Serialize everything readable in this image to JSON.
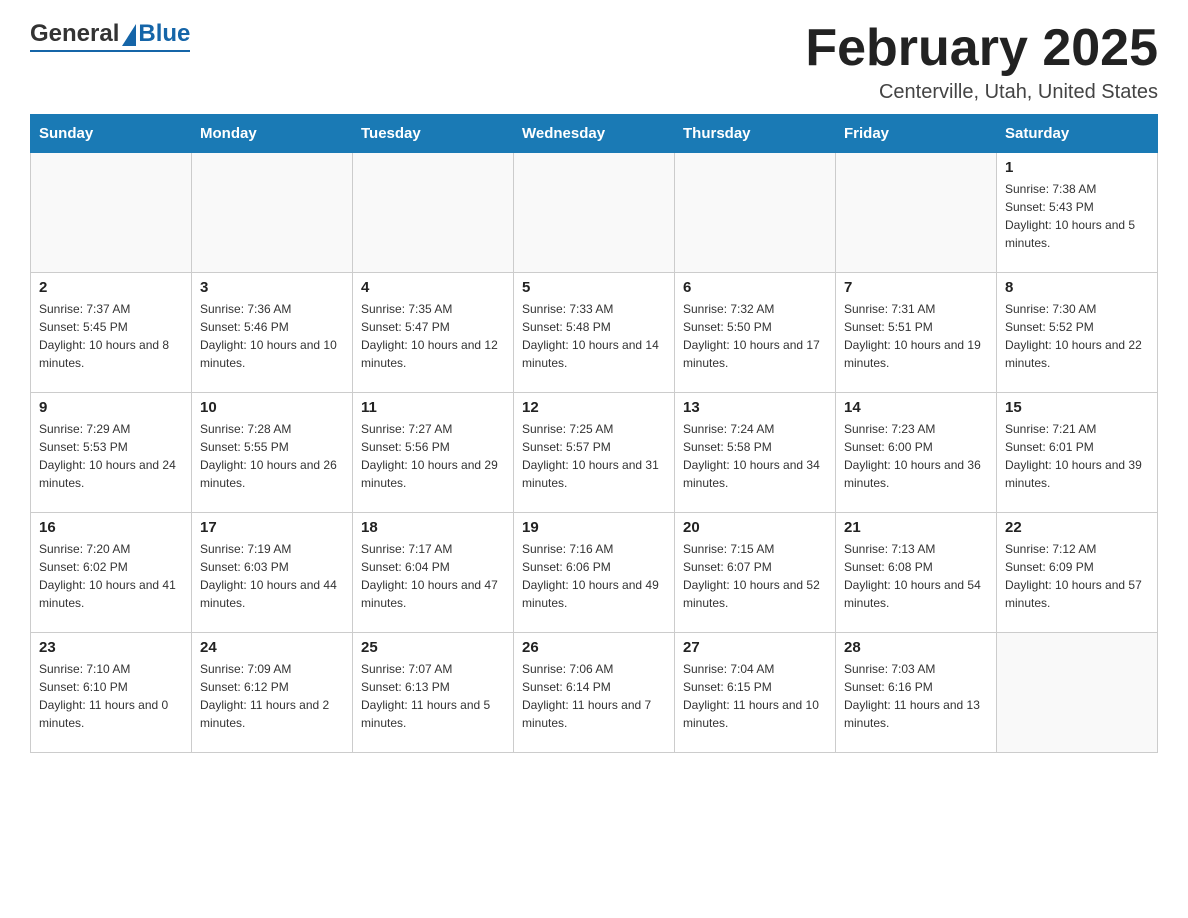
{
  "header": {
    "logo_general": "General",
    "logo_blue": "Blue",
    "month_title": "February 2025",
    "location": "Centerville, Utah, United States"
  },
  "weekdays": [
    "Sunday",
    "Monday",
    "Tuesday",
    "Wednesday",
    "Thursday",
    "Friday",
    "Saturday"
  ],
  "weeks": [
    [
      {
        "day": "",
        "sunrise": "",
        "sunset": "",
        "daylight": ""
      },
      {
        "day": "",
        "sunrise": "",
        "sunset": "",
        "daylight": ""
      },
      {
        "day": "",
        "sunrise": "",
        "sunset": "",
        "daylight": ""
      },
      {
        "day": "",
        "sunrise": "",
        "sunset": "",
        "daylight": ""
      },
      {
        "day": "",
        "sunrise": "",
        "sunset": "",
        "daylight": ""
      },
      {
        "day": "",
        "sunrise": "",
        "sunset": "",
        "daylight": ""
      },
      {
        "day": "1",
        "sunrise": "Sunrise: 7:38 AM",
        "sunset": "Sunset: 5:43 PM",
        "daylight": "Daylight: 10 hours and 5 minutes."
      }
    ],
    [
      {
        "day": "2",
        "sunrise": "Sunrise: 7:37 AM",
        "sunset": "Sunset: 5:45 PM",
        "daylight": "Daylight: 10 hours and 8 minutes."
      },
      {
        "day": "3",
        "sunrise": "Sunrise: 7:36 AM",
        "sunset": "Sunset: 5:46 PM",
        "daylight": "Daylight: 10 hours and 10 minutes."
      },
      {
        "day": "4",
        "sunrise": "Sunrise: 7:35 AM",
        "sunset": "Sunset: 5:47 PM",
        "daylight": "Daylight: 10 hours and 12 minutes."
      },
      {
        "day": "5",
        "sunrise": "Sunrise: 7:33 AM",
        "sunset": "Sunset: 5:48 PM",
        "daylight": "Daylight: 10 hours and 14 minutes."
      },
      {
        "day": "6",
        "sunrise": "Sunrise: 7:32 AM",
        "sunset": "Sunset: 5:50 PM",
        "daylight": "Daylight: 10 hours and 17 minutes."
      },
      {
        "day": "7",
        "sunrise": "Sunrise: 7:31 AM",
        "sunset": "Sunset: 5:51 PM",
        "daylight": "Daylight: 10 hours and 19 minutes."
      },
      {
        "day": "8",
        "sunrise": "Sunrise: 7:30 AM",
        "sunset": "Sunset: 5:52 PM",
        "daylight": "Daylight: 10 hours and 22 minutes."
      }
    ],
    [
      {
        "day": "9",
        "sunrise": "Sunrise: 7:29 AM",
        "sunset": "Sunset: 5:53 PM",
        "daylight": "Daylight: 10 hours and 24 minutes."
      },
      {
        "day": "10",
        "sunrise": "Sunrise: 7:28 AM",
        "sunset": "Sunset: 5:55 PM",
        "daylight": "Daylight: 10 hours and 26 minutes."
      },
      {
        "day": "11",
        "sunrise": "Sunrise: 7:27 AM",
        "sunset": "Sunset: 5:56 PM",
        "daylight": "Daylight: 10 hours and 29 minutes."
      },
      {
        "day": "12",
        "sunrise": "Sunrise: 7:25 AM",
        "sunset": "Sunset: 5:57 PM",
        "daylight": "Daylight: 10 hours and 31 minutes."
      },
      {
        "day": "13",
        "sunrise": "Sunrise: 7:24 AM",
        "sunset": "Sunset: 5:58 PM",
        "daylight": "Daylight: 10 hours and 34 minutes."
      },
      {
        "day": "14",
        "sunrise": "Sunrise: 7:23 AM",
        "sunset": "Sunset: 6:00 PM",
        "daylight": "Daylight: 10 hours and 36 minutes."
      },
      {
        "day": "15",
        "sunrise": "Sunrise: 7:21 AM",
        "sunset": "Sunset: 6:01 PM",
        "daylight": "Daylight: 10 hours and 39 minutes."
      }
    ],
    [
      {
        "day": "16",
        "sunrise": "Sunrise: 7:20 AM",
        "sunset": "Sunset: 6:02 PM",
        "daylight": "Daylight: 10 hours and 41 minutes."
      },
      {
        "day": "17",
        "sunrise": "Sunrise: 7:19 AM",
        "sunset": "Sunset: 6:03 PM",
        "daylight": "Daylight: 10 hours and 44 minutes."
      },
      {
        "day": "18",
        "sunrise": "Sunrise: 7:17 AM",
        "sunset": "Sunset: 6:04 PM",
        "daylight": "Daylight: 10 hours and 47 minutes."
      },
      {
        "day": "19",
        "sunrise": "Sunrise: 7:16 AM",
        "sunset": "Sunset: 6:06 PM",
        "daylight": "Daylight: 10 hours and 49 minutes."
      },
      {
        "day": "20",
        "sunrise": "Sunrise: 7:15 AM",
        "sunset": "Sunset: 6:07 PM",
        "daylight": "Daylight: 10 hours and 52 minutes."
      },
      {
        "day": "21",
        "sunrise": "Sunrise: 7:13 AM",
        "sunset": "Sunset: 6:08 PM",
        "daylight": "Daylight: 10 hours and 54 minutes."
      },
      {
        "day": "22",
        "sunrise": "Sunrise: 7:12 AM",
        "sunset": "Sunset: 6:09 PM",
        "daylight": "Daylight: 10 hours and 57 minutes."
      }
    ],
    [
      {
        "day": "23",
        "sunrise": "Sunrise: 7:10 AM",
        "sunset": "Sunset: 6:10 PM",
        "daylight": "Daylight: 11 hours and 0 minutes."
      },
      {
        "day": "24",
        "sunrise": "Sunrise: 7:09 AM",
        "sunset": "Sunset: 6:12 PM",
        "daylight": "Daylight: 11 hours and 2 minutes."
      },
      {
        "day": "25",
        "sunrise": "Sunrise: 7:07 AM",
        "sunset": "Sunset: 6:13 PM",
        "daylight": "Daylight: 11 hours and 5 minutes."
      },
      {
        "day": "26",
        "sunrise": "Sunrise: 7:06 AM",
        "sunset": "Sunset: 6:14 PM",
        "daylight": "Daylight: 11 hours and 7 minutes."
      },
      {
        "day": "27",
        "sunrise": "Sunrise: 7:04 AM",
        "sunset": "Sunset: 6:15 PM",
        "daylight": "Daylight: 11 hours and 10 minutes."
      },
      {
        "day": "28",
        "sunrise": "Sunrise: 7:03 AM",
        "sunset": "Sunset: 6:16 PM",
        "daylight": "Daylight: 11 hours and 13 minutes."
      },
      {
        "day": "",
        "sunrise": "",
        "sunset": "",
        "daylight": ""
      }
    ]
  ]
}
